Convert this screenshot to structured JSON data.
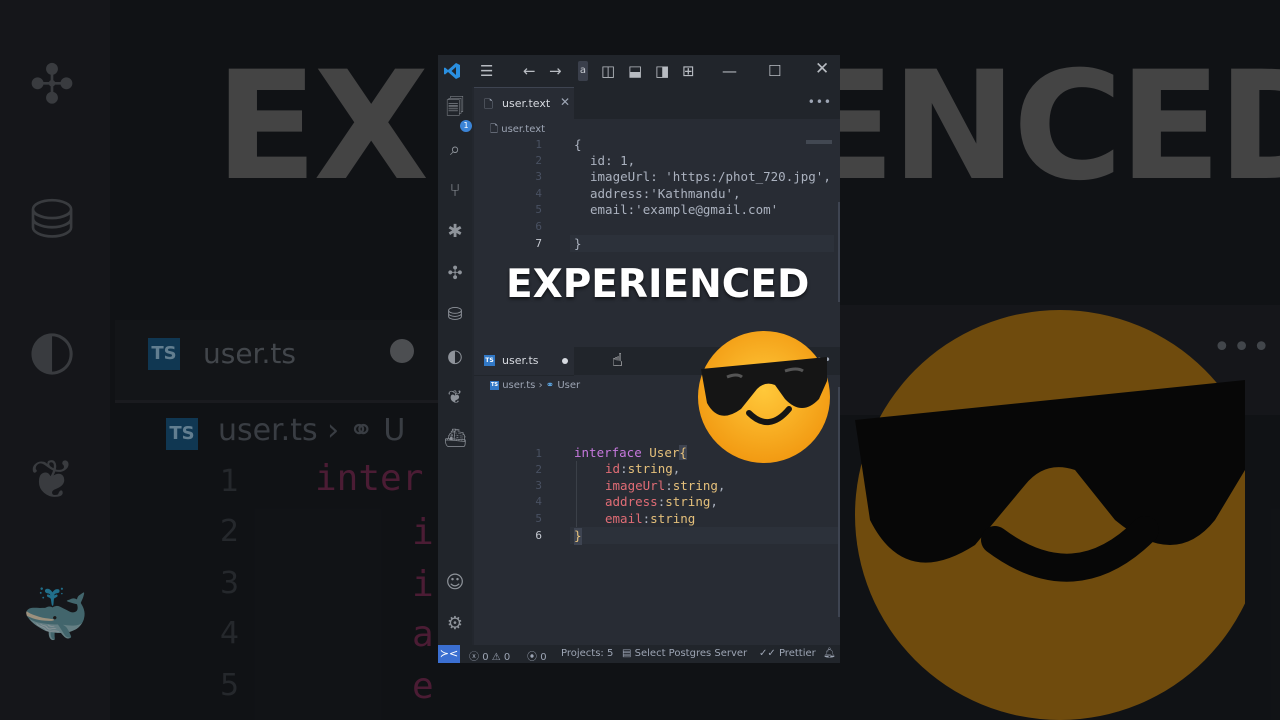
{
  "background": {
    "overlay_text_zoomed": "EXPERIENCED",
    "tab_label_zoomed": "user.ts",
    "crumb_zoomed": "user.ts",
    "line_numbers_zoomed": [
      "1",
      "2",
      "3",
      "4",
      "5"
    ],
    "code_zoomed": [
      "inter",
      "i",
      "i",
      "a",
      "e"
    ]
  },
  "titlebar": {
    "search_fragment": "a"
  },
  "activity_bar": {
    "explorer_badge": "1"
  },
  "top_editor": {
    "tab_label": "user.text",
    "breadcrumb": "user.text",
    "line_numbers": [
      "1",
      "2",
      "3",
      "4",
      "5",
      "6",
      "7"
    ],
    "lines": {
      "l1": "{",
      "l2_key": "id",
      "l2_val": "1",
      "l3_key": "imageUrl",
      "l3_val": "'https:/phot_720.jpg'",
      "l4_key": "address",
      "l4_val": "'Kathmandu'",
      "l5_key": "email",
      "l5_val": "'example@gmail.com'",
      "l7": "}"
    }
  },
  "bottom_editor": {
    "tab_label": "user.ts",
    "breadcrumb_file": "user.ts",
    "breadcrumb_symbol": "User",
    "ts_badge": "TS",
    "line_numbers": [
      "1",
      "2",
      "3",
      "4",
      "5",
      "6"
    ],
    "lines": {
      "keyword": "interface",
      "type_name": "User",
      "brace_open": "{",
      "props": [
        {
          "name": "id",
          "type": "string",
          "sep": ","
        },
        {
          "name": "imageUrl",
          "type": "string",
          "sep": ","
        },
        {
          "name": "address",
          "type": "string",
          "sep": ","
        },
        {
          "name": "email",
          "type": "string",
          "sep": ""
        }
      ],
      "brace_close": "}"
    }
  },
  "overlay_caption": "EXPERIENCED",
  "status_bar": {
    "errors": "0",
    "warnings": "0",
    "ports": "0",
    "projects": "Projects: 5",
    "postgres": "Select Postgres Server",
    "prettier": "Prettier"
  },
  "colors": {
    "editor_bg": "#282c34",
    "chrome_bg": "#21252b",
    "accent": "#3b6fd1",
    "emoji_yellow": "#f5a623"
  }
}
